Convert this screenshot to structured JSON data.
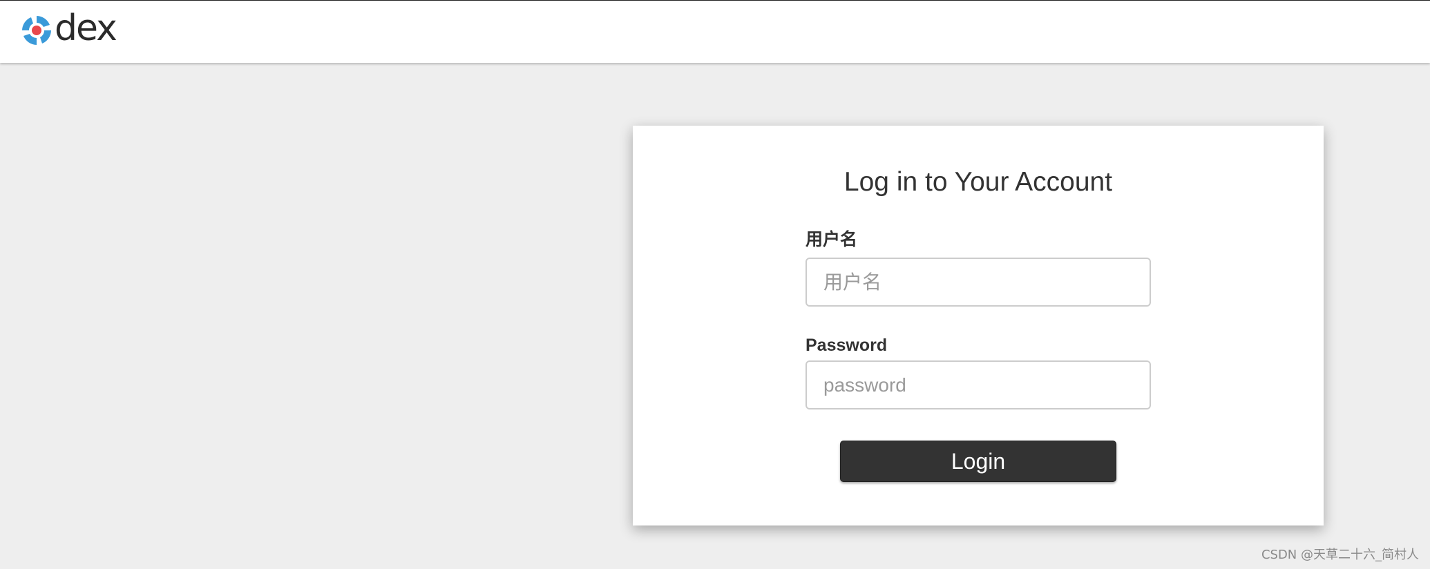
{
  "header": {
    "logo_text": "dex",
    "logo_icon": "dex-logo-icon",
    "brand_colors": {
      "blue": "#3a9ad9",
      "red": "#e8474c"
    }
  },
  "login_card": {
    "title": "Log in to Your Account",
    "username_label": "用户名",
    "username_placeholder": "用户名",
    "username_value": "",
    "password_label": "Password",
    "password_placeholder": "password",
    "password_value": "",
    "login_button_label": "Login"
  },
  "watermark": "CSDN @天草二十六_简村人",
  "colors": {
    "background": "#eeeeee",
    "card": "#ffffff",
    "button": "#333333",
    "text": "#333333"
  }
}
